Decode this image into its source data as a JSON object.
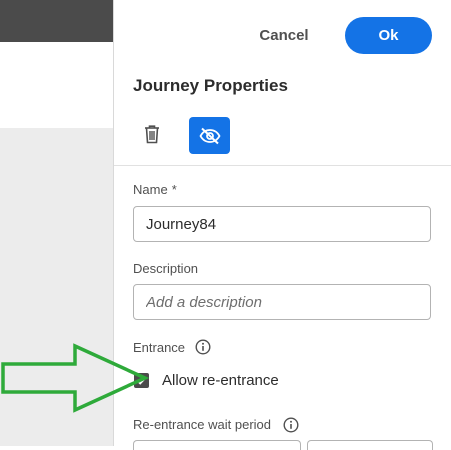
{
  "header": {
    "cancel_label": "Cancel",
    "ok_label": "Ok"
  },
  "panel": {
    "title": "Journey Properties",
    "toolbar": {
      "delete_icon": "trash-icon",
      "visibility_icon": "eye-off-icon"
    },
    "name": {
      "label": "Name",
      "required_mark": "*",
      "value": "Journey84"
    },
    "description": {
      "label": "Description",
      "placeholder": "Add a description"
    },
    "entrance": {
      "label": "Entrance",
      "info_icon": "info-icon",
      "allow_reentrance_label": "Allow re-entrance",
      "allow_reentrance_checked": true
    },
    "reentrance_wait": {
      "label": "Re-entrance wait period",
      "info_icon": "info-icon"
    }
  },
  "colors": {
    "accent": "#1473e6",
    "annotation_arrow": "#2eaa3a",
    "topbar": "#4b4b4b"
  },
  "annotation": {
    "icon": "arrow-right-icon"
  }
}
